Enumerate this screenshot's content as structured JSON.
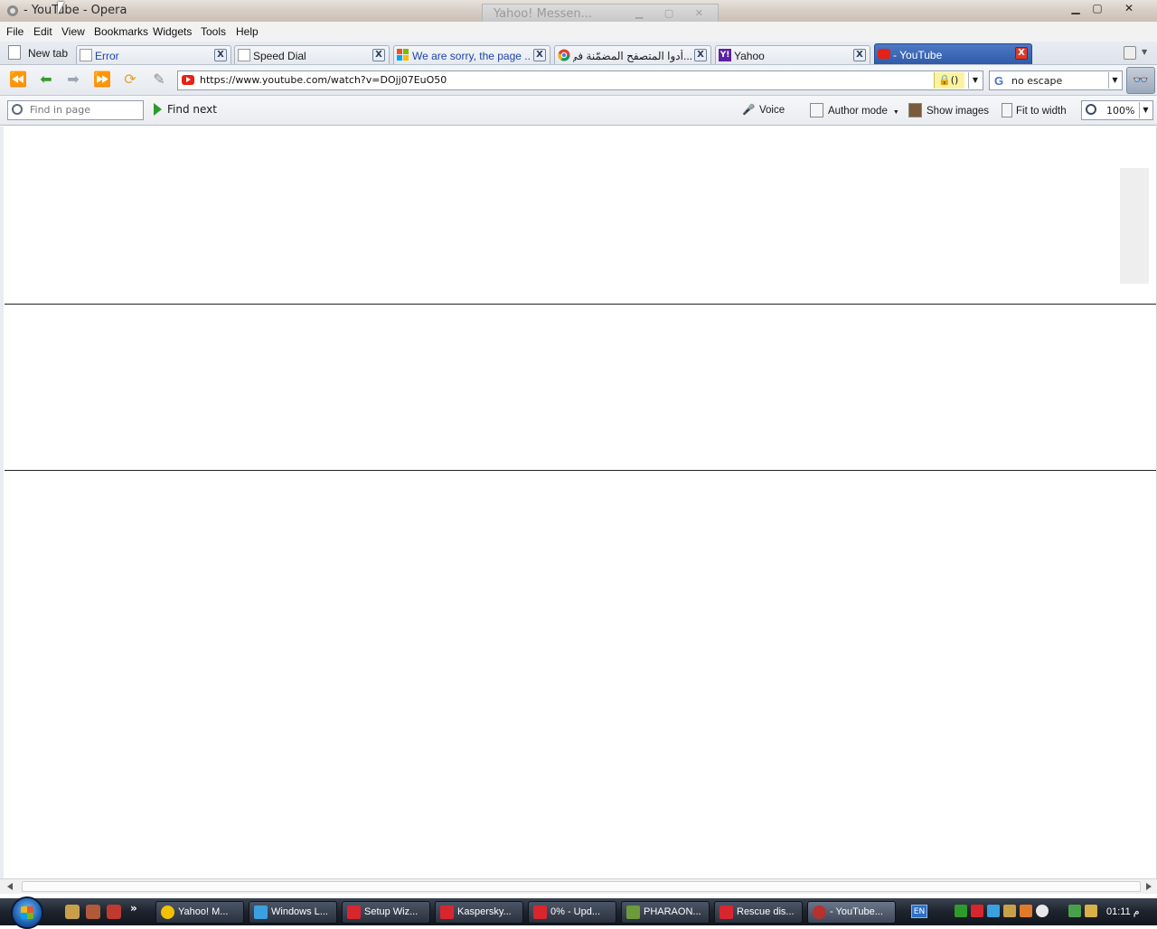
{
  "window": {
    "title": "- YouTube - Opera",
    "background_window_title": "Yahoo! Messen..."
  },
  "menu": {
    "items": [
      "File",
      "Edit",
      "View",
      "Bookmarks",
      "Widgets",
      "Tools",
      "Help"
    ]
  },
  "tabs": {
    "new_tab_label": "New tab",
    "items": [
      {
        "label": "Error",
        "favicon": "page-icon",
        "active": false
      },
      {
        "label": "Speed Dial",
        "favicon": "page-icon",
        "active": false
      },
      {
        "label": "We are sorry, the page ...",
        "favicon": "windows-logo-icon",
        "active": false
      },
      {
        "label": "...أدوا المتصفح المضمّنة في",
        "favicon": "chrome-icon",
        "active": false
      },
      {
        "label": "Yahoo",
        "favicon": "yahoo-icon",
        "active": false
      },
      {
        "label": "- YouTube",
        "favicon": "youtube-icon",
        "active": true
      }
    ]
  },
  "address_bar": {
    "url": "https://www.youtube.com/watch?v=DOjj07EuO50",
    "security_badge": "()",
    "search_engine_icon": "G",
    "search_value": "no escape"
  },
  "find_bar": {
    "placeholder": "Find in page",
    "find_next_label": "Find next",
    "voice_label": "Voice",
    "author_mode_label": "Author mode",
    "show_images_label": "Show images",
    "fit_to_width_label": "Fit to width",
    "zoom_value": "100%"
  },
  "taskbar": {
    "tasks": [
      {
        "label": "Yahoo! M...",
        "color": "#f2c200"
      },
      {
        "label": "Windows L...",
        "color": "#3aa0e0"
      },
      {
        "label": "Setup Wiz...",
        "color": "#d8262e"
      },
      {
        "label": "Kaspersky...",
        "color": "#d8262e"
      },
      {
        "label": "0% - Upd...",
        "color": "#d8262e"
      },
      {
        "label": "PHARAON...",
        "color": "#6b9b3a"
      },
      {
        "label": "Rescue dis...",
        "color": "#d8262e"
      },
      {
        "label": "- YouTube...",
        "color": "#b8312f"
      }
    ],
    "language": "EN",
    "clock": "01:11 م"
  },
  "colors": {
    "active_tab": "#2f5aa8",
    "youtube_red": "#e62117"
  }
}
